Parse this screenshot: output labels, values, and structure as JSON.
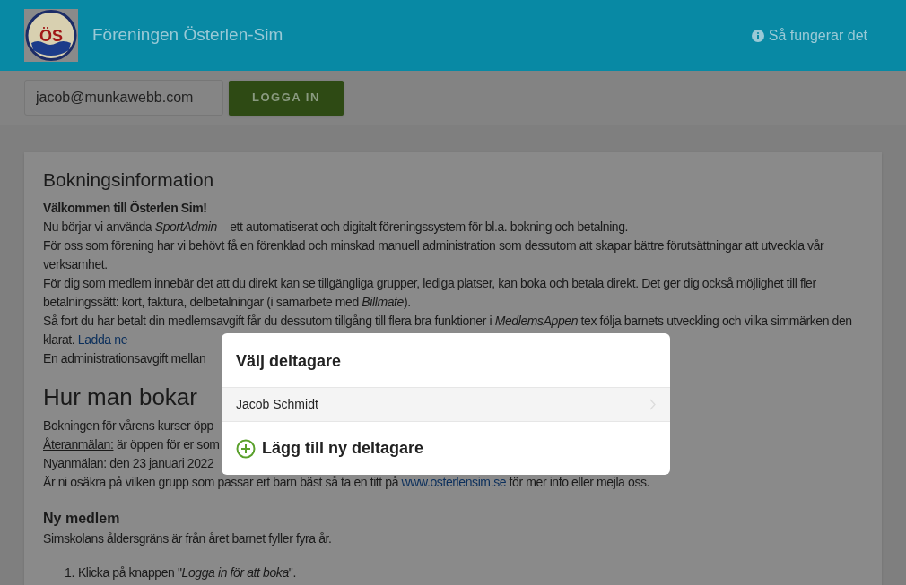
{
  "header": {
    "logo_text": "ÖS",
    "title": "Föreningen Österlen-Sim",
    "help_link": "Så fungerar det"
  },
  "login": {
    "email": "jacob@munkawebb.com",
    "button": "LOGGA IN"
  },
  "card": {
    "heading": "Bokningsinformation",
    "blocks": [
      {
        "kind": "line",
        "segments": [
          {
            "kind": "bold",
            "text": "Välkommen till Österlen Sim!"
          }
        ]
      },
      {
        "kind": "line",
        "segments": [
          {
            "kind": "text",
            "text": "Nu börjar vi använda *SportAdmin* – ett automatiserat och digitalt föreningssystem för bl.a. bokning och betalning."
          }
        ]
      },
      {
        "kind": "line",
        "segments": [
          {
            "kind": "text",
            "text": "För oss som förening har vi behövt få en förenklad och minskad manuell administration som dessutom att skapar bättre förutsättningar att utveckla vår verksamhet."
          }
        ]
      },
      {
        "kind": "line",
        "segments": [
          {
            "kind": "text",
            "text": "För dig som medlem innebär det att du direkt kan se tillgängliga grupper, lediga platser, kan boka och betala direkt. Det ger dig också möjlighet till fler betalningssätt: kort, faktura, delbetalningar (i samarbete med *Billmate*)."
          }
        ]
      },
      {
        "kind": "line",
        "segments": [
          {
            "kind": "text",
            "text": "Så fort du har betalt din medlemsavgift får du dessutom tillgång till flera bra funktioner i *MedlemsAppen* tex följa barnets utveckling och vilka simmärken den klarat. "
          },
          {
            "kind": "link",
            "text": "Ladda ne"
          }
        ]
      },
      {
        "kind": "line",
        "segments": [
          {
            "kind": "text",
            "text": "En administrationsavgift mellan"
          }
        ]
      },
      {
        "kind": "heading",
        "segments": [
          {
            "kind": "text",
            "text": "Hur man bokar"
          }
        ]
      },
      {
        "kind": "line",
        "segments": [
          {
            "kind": "text",
            "text": "Bokningen för vårens kurser öpp"
          }
        ]
      },
      {
        "kind": "line",
        "segments": [
          {
            "kind": "underline",
            "text": "Återanmälan:"
          },
          {
            "kind": "text",
            "text": " är öppen för er som"
          }
        ]
      },
      {
        "kind": "line",
        "segments": [
          {
            "kind": "underline",
            "text": "Nyanmälan:"
          },
          {
            "kind": "text",
            "text": " den 23 januari 2022"
          }
        ]
      },
      {
        "kind": "line",
        "segments": [
          {
            "kind": "text",
            "text": "Är ni osäkra på vilken grupp som passar ert barn bäst så ta en titt på "
          },
          {
            "kind": "link",
            "text": "www.osterlensim.se"
          },
          {
            "kind": "text",
            "text": " för mer info eller mejla oss."
          }
        ]
      },
      {
        "kind": "subheading",
        "segments": [
          {
            "kind": "text",
            "text": "Ny medlem"
          }
        ]
      },
      {
        "kind": "line",
        "segments": [
          {
            "kind": "text",
            "text": "Simskolans åldersgräns är från året barnet fyller fyra år."
          }
        ]
      },
      {
        "kind": "list_item",
        "number": "1.",
        "segments": [
          {
            "kind": "text",
            "text": "Klicka på knappen \"*Logga in för att boka*\"."
          }
        ]
      }
    ]
  },
  "modal": {
    "title": "Välj deltagare",
    "participants": [
      {
        "name": "Jacob Schmidt"
      }
    ],
    "add_button": "Lägg till ny deltagare"
  }
}
